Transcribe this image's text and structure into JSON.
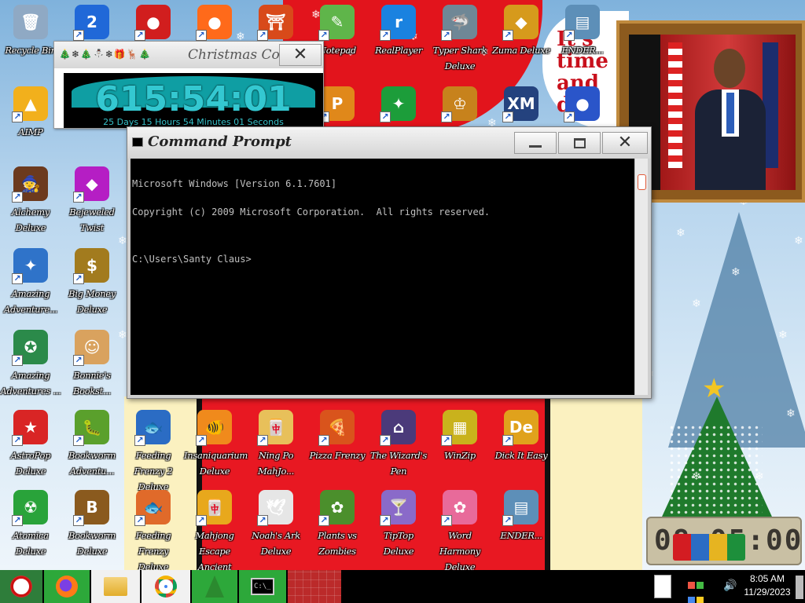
{
  "desktop_icons": [
    {
      "label": "Recycle Bin",
      "color": "#8fa9c4",
      "glyph": "🗑"
    },
    {
      "label": "",
      "color": "#2068d8",
      "glyph": "2"
    },
    {
      "label": "",
      "color": "#d11e1e",
      "glyph": "●"
    },
    {
      "label": "",
      "color": "#ff6a1a",
      "glyph": "●"
    },
    {
      "label": "",
      "color": "#d84a1a",
      "glyph": "⛩"
    },
    {
      "label": "Notepad",
      "color": "#5fb54a",
      "glyph": "✎"
    },
    {
      "label": "RealPlayer",
      "color": "#1a82e0",
      "glyph": "r"
    },
    {
      "label": "Typer Shark Deluxe",
      "color": "#6f8796",
      "glyph": "🦈"
    },
    {
      "label": "Zuma Deluxe",
      "color": "#d69a1c",
      "glyph": "◆"
    },
    {
      "label": "ENDER...",
      "color": "#5d8fb8",
      "glyph": "▤"
    },
    {
      "label": "AIMP",
      "color": "#f2b01c",
      "glyph": "▲"
    },
    {
      "label": "",
      "color": "#e0881a",
      "glyph": "P"
    },
    {
      "label": "",
      "color": "#1c9d3a",
      "glyph": "✦"
    },
    {
      "label": "",
      "color": "#c7821c",
      "glyph": "♔"
    },
    {
      "label": "XM play",
      "color": "#24427e",
      "glyph": "XM"
    },
    {
      "label": "",
      "color": "#2a55c9",
      "glyph": "●"
    },
    {
      "label": "Alchemy Deluxe",
      "color": "#6c3a1e",
      "glyph": "🧙"
    },
    {
      "label": "Bejeweled Twist",
      "color": "#b51ec4",
      "glyph": "◆"
    },
    {
      "label": "Amazing Adventure...",
      "color": "#2f73c9",
      "glyph": "✦"
    },
    {
      "label": "Big Money Deluxe",
      "color": "#a27b1e",
      "glyph": "$"
    },
    {
      "label": "Amazing Adventures ...",
      "color": "#2b8a4a",
      "glyph": "✪"
    },
    {
      "label": "Bonnie's Bookst...",
      "color": "#d9a25e",
      "glyph": "☺"
    },
    {
      "label": "AstroPop Deluxe",
      "color": "#d92525",
      "glyph": "★"
    },
    {
      "label": "Bookworm Adventu...",
      "color": "#5aa02c",
      "glyph": "🐛"
    },
    {
      "label": "Feeding Frenzy 2 Deluxe",
      "color": "#2b6cc4",
      "glyph": "🐟"
    },
    {
      "label": "Insaniquarium Deluxe",
      "color": "#f08a1c",
      "glyph": "🐠"
    },
    {
      "label": "Ning Po MahJo...",
      "color": "#e8c05a",
      "glyph": "🀄"
    },
    {
      "label": "Pizza Frenzy",
      "color": "#d9541c",
      "glyph": "🍕"
    },
    {
      "label": "The Wizard's Pen",
      "color": "#4b3a7a",
      "glyph": "⌂"
    },
    {
      "label": "WinZip",
      "color": "#c9b21c",
      "glyph": "▦"
    },
    {
      "label": "Dick It Easy",
      "color": "#e0a21c",
      "glyph": "De"
    },
    {
      "label": "Atomica Deluxe",
      "color": "#29a33a",
      "glyph": "☢"
    },
    {
      "label": "Bookworm Deluxe",
      "color": "#8a5a1e",
      "glyph": "B"
    },
    {
      "label": "Feeding Frenzy Deluxe",
      "color": "#e06a2a",
      "glyph": "🐟"
    },
    {
      "label": "Mahjong Escape Ancient China",
      "color": "#e8a81c",
      "glyph": "🀄"
    },
    {
      "label": "Noah's Ark Deluxe",
      "color": "#e6e6e6",
      "glyph": "🕊"
    },
    {
      "label": "Plants vs Zombies",
      "color": "#4b8f2c",
      "glyph": "✿"
    },
    {
      "label": "TipTop Deluxe",
      "color": "#8a6ac9",
      "glyph": "🍸"
    },
    {
      "label": "Word Harmony Deluxe",
      "color": "#e86a9a",
      "glyph": "✿"
    },
    {
      "label": "ENDER...",
      "color": "#5d8fb8",
      "glyph": "▤"
    }
  ],
  "countdown_gadget": {
    "decorations": "🎄❄🎄⛄❄🎁🦌🎄",
    "title": "Christmas Countdown",
    "close": "✕",
    "time": "615:54:01",
    "subtitle": "25 Days 15 Hours 54 Minutes 01 Seconds"
  },
  "speech_bubble": "It's time and d...",
  "cmd_window": {
    "title": "Command Prompt",
    "close": "✕",
    "console_lines": [
      "Microsoft Windows [Version 6.1.7601]",
      "Copyright (c) 2009 Microsoft Corporation.  All rights reserved.",
      "",
      "C:\\Users\\Santy Claus>"
    ]
  },
  "led_clock": "08:05:00",
  "taskbar": {
    "items": [
      "Firefox",
      "Windows Explorer",
      "Google Chrome",
      "Christmas Countdown",
      "Command Prompt"
    ],
    "cmd_thumb": "C:\\_",
    "clock_time": "8:05 AM",
    "clock_date": "11/29/2023"
  },
  "colors": {
    "accent_teal": "#34c8d1",
    "santa_red": "#e2141c",
    "taskbar": "#000000"
  }
}
